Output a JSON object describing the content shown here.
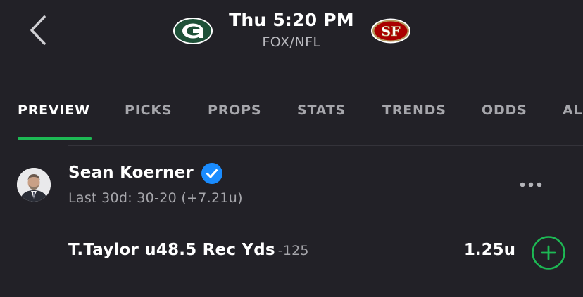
{
  "header": {
    "back_icon": "chevron-left-icon",
    "game_time": "Thu 5:20 PM",
    "network": "FOX/NFL",
    "away_team_logo": "packers-logo",
    "home_team_logo": "49ers-logo",
    "colors": {
      "packers_green": "#203731",
      "packers_gold": "#FFB612",
      "niners_red": "#AA0000",
      "niners_gold": "#B3995D"
    }
  },
  "tabs": [
    {
      "label": "PREVIEW",
      "active": true
    },
    {
      "label": "PICKS"
    },
    {
      "label": "PROPS"
    },
    {
      "label": "STATS"
    },
    {
      "label": "TRENDS"
    },
    {
      "label": "ODDS"
    },
    {
      "label": "AL"
    }
  ],
  "accent_color": "#1db954",
  "pick_card": {
    "author": {
      "name": "Sean Koerner",
      "verified_icon": "verified-check-icon",
      "record": "Last 30d: 30-20 (+7.21u)"
    },
    "more_icon": "more-horizontal-icon",
    "pick": {
      "selection": "T.Taylor u48.5 Rec Yds",
      "odds": "-125",
      "units": "1.25u",
      "add_icon": "plus-circle-icon"
    }
  }
}
